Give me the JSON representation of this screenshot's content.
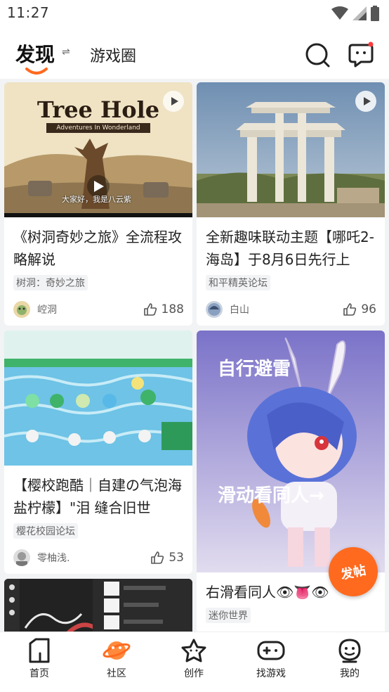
{
  "status_bar": {
    "time": "11:27"
  },
  "header": {
    "active_tab": "发现",
    "swap_symbol": "⇌",
    "other_tab": "游戏圈"
  },
  "cards": [
    {
      "image_text": "Tree Hole",
      "image_subtext": "Adventures In Wonderland",
      "image_caption": "大家好，我是八云紫",
      "title": "《树洞奇妙之旅》全流程攻略解说",
      "tag": "树洞：奇妙之旅",
      "author": "崆洞",
      "likes": "188"
    },
    {
      "title": "全新趣味联动主题【哪吒2-海岛】于8月6日先行上",
      "tag": "和平精英论坛",
      "author": "白山",
      "likes": "96"
    },
    {
      "title": "【樱校跑酷｜自建の气泡海盐柠檬】\"泪 缝合旧世",
      "tag": "樱花校园论坛",
      "author": "零柚浅.",
      "likes": "53"
    },
    {
      "image_text_top": "自行避雷",
      "image_text_bottom": "滑动看同人→",
      "title": "右滑看同人👁👅👁",
      "tag": "迷你世界"
    }
  ],
  "fab": {
    "label": "发帖"
  },
  "bottom_nav": [
    {
      "label": "首页"
    },
    {
      "label": "社区"
    },
    {
      "label": "创作"
    },
    {
      "label": "找游戏"
    },
    {
      "label": "我的"
    }
  ],
  "colors": {
    "accent": "#ff6a1f",
    "background": "#f2f3f5"
  }
}
